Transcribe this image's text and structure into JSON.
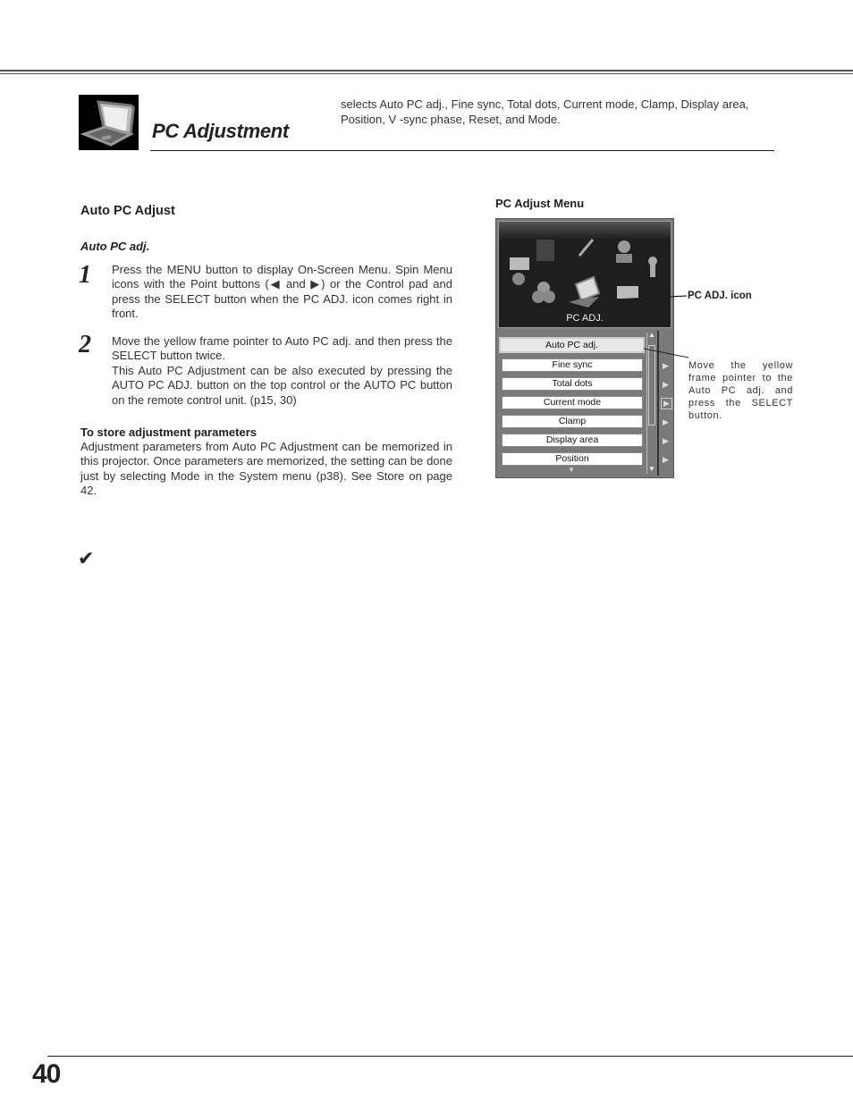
{
  "header": {
    "section_title": "PC Adjustment",
    "intro": "selects Auto PC adj., Fine sync, Total dots, Current mode, Clamp, Display area, Position, V -sync phase, Reset, and Mode."
  },
  "left": {
    "heading": "Auto PC Adjust",
    "subheading": "Auto PC adj.",
    "steps": [
      {
        "num": "1",
        "text": "Press the MENU button to display On-Screen Menu. Spin Menu icons with the Point buttons (◀ and ▶) or the Control pad and press the SELECT button when the PC ADJ. icon comes right in front."
      },
      {
        "num": "2",
        "text": "Move the yellow frame pointer to Auto PC adj. and then press the SELECT button twice.",
        "text2": "This Auto PC Adjustment can be also executed by pressing the AUTO PC ADJ. button on the top control or the AUTO PC button on the remote control unit. (p15, 30)"
      }
    ],
    "store_heading": "To store adjustment parameters",
    "store_text": "Adjustment parameters from Auto PC Adjustment can be memorized in this projector. Once parameters are memorized, the setting can be done just by selecting Mode in the System menu (p38). See Store on page 42.",
    "check_icon": "✔"
  },
  "menu": {
    "caption": "PC Adjust Menu",
    "osd_label": "PC ADJ.",
    "items": [
      "Auto PC adj.",
      "Fine sync",
      "Total dots",
      "Current mode",
      "Clamp",
      "Display area",
      "Position"
    ],
    "selected_index": 0,
    "scroll_up": "▲",
    "scroll_down": "▼",
    "more": "▼",
    "arrow": "▶",
    "callout_icon": "PC ADJ. icon",
    "callout_text": "Move the yellow frame pointer to the Auto PC adj. and press the SELECT button."
  },
  "footer": {
    "page_number": "40"
  }
}
